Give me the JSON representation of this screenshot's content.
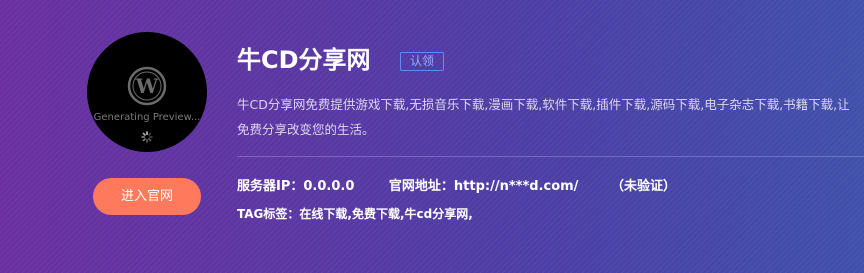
{
  "avatar": {
    "logo_icon": "wordpress-icon",
    "preview_text": "Generating Preview...",
    "spinner_icon": "loading-spinner-icon"
  },
  "enter_button": {
    "label": "进入官网"
  },
  "site": {
    "title": "牛CD分享网",
    "claim_label": "认领",
    "description": "牛CD分享网免费提供游戏下载,无损音乐下载,漫画下载,软件下载,插件下载,源码下载,电子杂志下载,书籍下载,让免费分享改变您的生活。"
  },
  "info": {
    "server_ip_label": "服务器IP：",
    "server_ip_value": "0.0.0.0",
    "site_url_label": "官网地址：",
    "site_url_value": "http://n***d.com/",
    "verify_status": "（未验证）"
  },
  "tags": {
    "label": "TAG标签：",
    "items": [
      "在线下载,",
      "免费下载,",
      "牛cd分享网,"
    ]
  },
  "colors": {
    "background_start": "#6a2fa0",
    "background_end": "#4050ab",
    "button": "#ff7a5c",
    "badge_border": "#5b8cff"
  }
}
